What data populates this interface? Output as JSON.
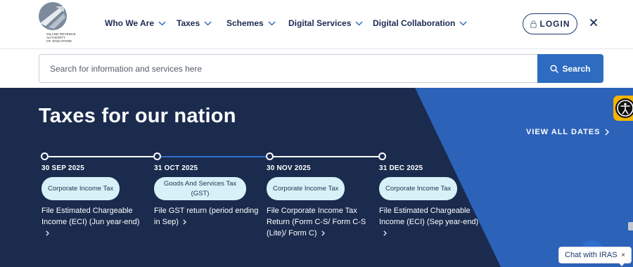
{
  "logo": {
    "line1": "INLAND REVENUE",
    "line2": "AUTHORITY",
    "line3": "OF SINGAPORE"
  },
  "nav": [
    {
      "label": "Who We Are"
    },
    {
      "label": "Taxes"
    },
    {
      "label": "Schemes"
    },
    {
      "label": "Digital Services"
    },
    {
      "label": "Digital Collaboration"
    }
  ],
  "header": {
    "login_label": "LOGIN"
  },
  "search": {
    "placeholder": "Search for information and services here",
    "button_label": "Search"
  },
  "hero": {
    "title": "Taxes for our nation",
    "view_all_label": "VIEW ALL DATES"
  },
  "timeline": [
    {
      "date": "30 SEP 2025",
      "tag": "Corporate Income Tax",
      "description": "File Estimated Chargeable Income (ECI) (Jun year-end)"
    },
    {
      "date": "31 OCT 2025",
      "tag": "Goods And Services Tax (GST)",
      "description": "File GST return (period ending in Sep)"
    },
    {
      "date": "30 NOV 2025",
      "tag": "Corporate Income Tax",
      "description": "File Corporate Income Tax Return (Form C-S/ Form C-S (Lite)/ Form C)"
    },
    {
      "date": "31 DEC 2025",
      "tag": "Corporate Income Tax",
      "description": "File Estimated Chargeable Income (ECI) (Sep year-end)"
    }
  ],
  "chat": {
    "label": "Chat with IRAS",
    "close_glyph": "×"
  },
  "colors": {
    "navy": "#1a2b4e",
    "diagonal_blue": "#2c62b8",
    "accent_blue": "#2d6cc0",
    "pill_bg": "#d6f1f7",
    "accessibility_yellow": "#f4b400"
  }
}
